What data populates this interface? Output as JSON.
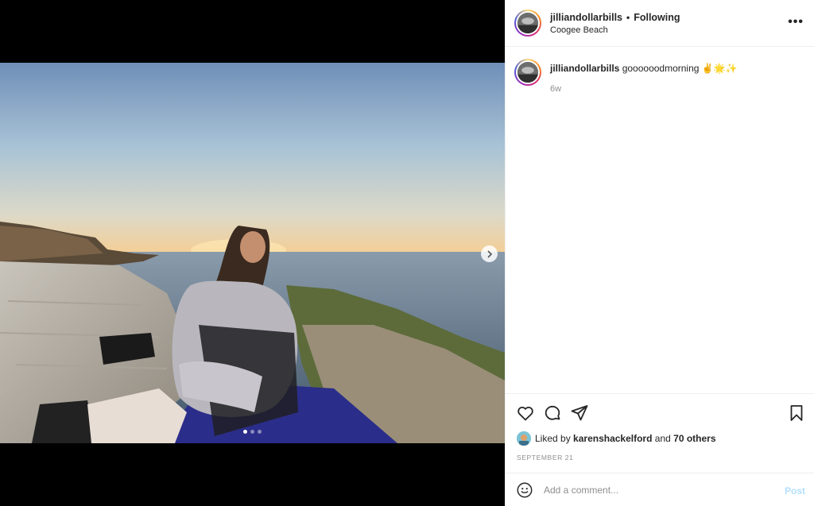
{
  "post": {
    "username": "jilliandollarbills",
    "follow_status": "Following",
    "separator": "•",
    "location": "Coogee Beach",
    "more_label": "•••"
  },
  "caption": {
    "username": "jilliandollarbills",
    "text": "goooooodmorning ✌️🌟✨",
    "age": "6w"
  },
  "media": {
    "slide_count": 3,
    "active_slide": 0
  },
  "actions": {
    "icons": [
      "heart-icon",
      "comment-icon",
      "share-icon",
      "bookmark-icon"
    ]
  },
  "likes": {
    "prefix": "Liked by",
    "liked_by_user": "karenshackelford",
    "and": "and",
    "others": "70 others"
  },
  "date": "SEPTEMBER 21",
  "comment": {
    "placeholder": "Add a comment...",
    "post_label": "Post"
  },
  "colors": {
    "post_button": "#b2dffc",
    "muted_text": "#8e8e8e"
  }
}
